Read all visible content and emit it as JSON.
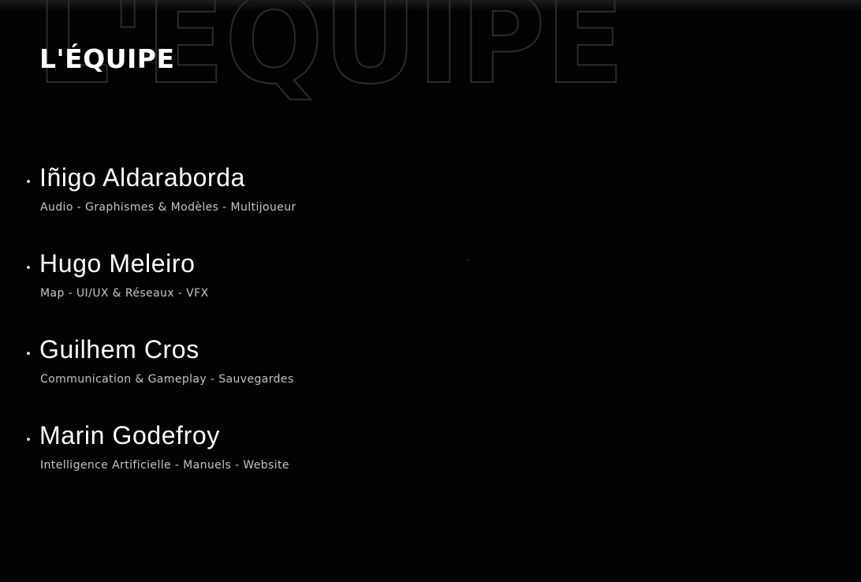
{
  "section": {
    "title": "L'ÉQUIPE",
    "background_watermark": "L'ÉQUIPE"
  },
  "team": [
    {
      "name": "Iñigo Aldaraborda",
      "roles": "Audio - Graphismes & Modèles - Multijoueur"
    },
    {
      "name": "Hugo Meleiro",
      "roles": "Map - UI/UX & Réseaux - VFX"
    },
    {
      "name": "Guilhem Cros",
      "roles": "Communication & Gameplay - Sauvegardes"
    },
    {
      "name": "Marin Godefroy",
      "roles": "Intelligence Artificielle - Manuels - Website"
    }
  ],
  "colors": {
    "background": "#030303",
    "title": "#ffffff",
    "name": "#ffffff",
    "roles": "#c4c4c4",
    "watermark_stroke": "#2c2c2c"
  }
}
